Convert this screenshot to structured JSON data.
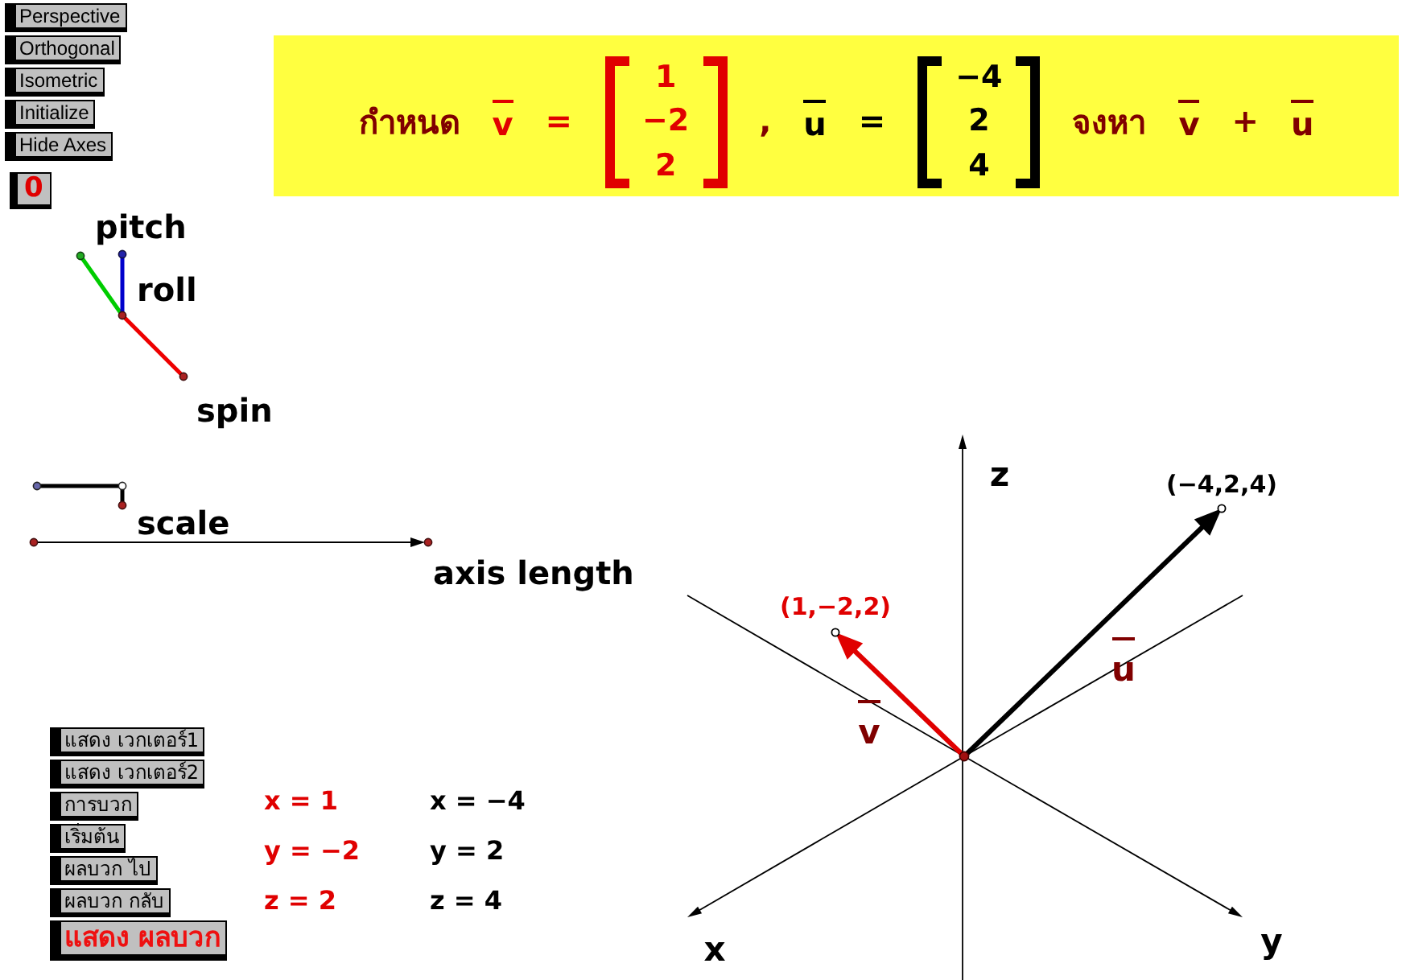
{
  "view_buttons": [
    "Perspective",
    "Orthogonal",
    "Isometric",
    "Initialize",
    "Hide Axes"
  ],
  "counter_button": "0",
  "problem_banner": [
    {
      "kind": "word",
      "text": "กำหนด",
      "color": "#800000"
    },
    {
      "kind": "vector",
      "text": "v",
      "color": "#e00000"
    },
    {
      "kind": "symbol",
      "text": "=",
      "color": "#e00000"
    },
    {
      "kind": "matrix",
      "entries": [
        "1",
        "−2",
        "2"
      ],
      "color": "#e00000"
    },
    {
      "kind": "symbol",
      "text": ",",
      "color": "#800000"
    },
    {
      "kind": "vector",
      "text": "u",
      "color": "#000000"
    },
    {
      "kind": "symbol",
      "text": "=",
      "color": "#000000"
    },
    {
      "kind": "matrix",
      "entries": [
        "−4",
        "2",
        "4"
      ],
      "color": "#000000"
    },
    {
      "kind": "word",
      "text": "จงหา",
      "color": "#800000"
    },
    {
      "kind": "vector",
      "text": "v",
      "color": "#800000"
    },
    {
      "kind": "symbol",
      "text": "+",
      "color": "#800000"
    },
    {
      "kind": "vector",
      "text": "u",
      "color": "#800000"
    }
  ],
  "orientation_control": {
    "pitch_label": "pitch",
    "roll_label": "roll",
    "spin_label": "spin"
  },
  "scale_control": {
    "label": "scale"
  },
  "axis_length_control": {
    "label": "axis length"
  },
  "action_buttons": [
    {
      "label": "แสดง เวกเตอร์1",
      "kind": "standard"
    },
    {
      "label": "แสดง เวกเตอร์2",
      "kind": "standard"
    },
    {
      "label": "การบวก",
      "kind": "standard"
    },
    {
      "label": "เริ่มต้น",
      "kind": "standard"
    },
    {
      "label": "ผลบวก ไป",
      "kind": "standard"
    },
    {
      "label": "ผลบวก กลับ",
      "kind": "standard"
    },
    {
      "label": "แสดง ผลบวก",
      "kind": "emphasis"
    }
  ],
  "coordinate_columns": [
    {
      "color": "#e00000",
      "lines": [
        "x = 1",
        "y = −2",
        "z = 2"
      ]
    },
    {
      "color": "#000000",
      "lines": [
        "x = −4",
        "y = 2",
        "z = 4"
      ]
    }
  ],
  "plot": {
    "axis_labels": {
      "x": "x",
      "y": "y",
      "z": "z"
    },
    "vectors": [
      {
        "name": "v",
        "tip_label": "(1,−2,2)",
        "color": "#e00000"
      },
      {
        "name": "u",
        "tip_label": "(−4,2,4)",
        "color": "#000000"
      }
    ]
  }
}
